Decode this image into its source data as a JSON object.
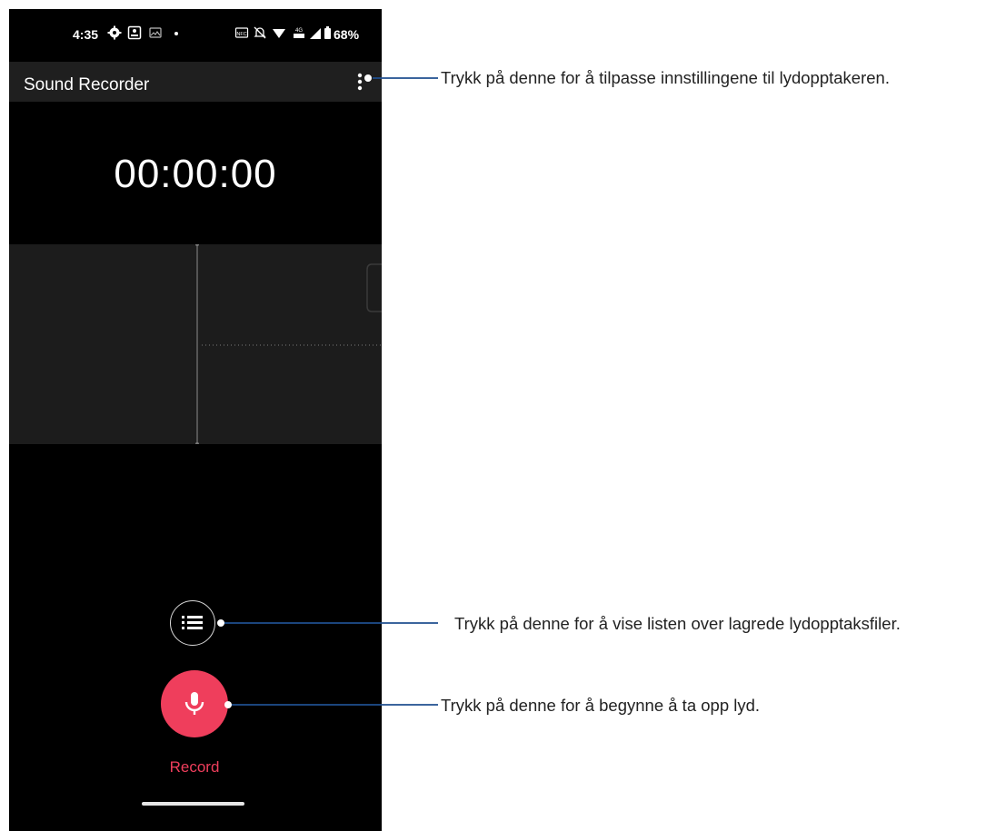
{
  "status_bar": {
    "time": "4:35",
    "battery_percent": "68%",
    "icons": [
      "settings-icon",
      "photo-icon",
      "image-icon",
      "dot-icon",
      "nfc-icon",
      "mute-icon",
      "wifi-icon",
      "lte-icon",
      "signal-icon",
      "battery-icon"
    ]
  },
  "app_bar": {
    "title": "Sound Recorder",
    "menu_icon": "more-vert-icon"
  },
  "timer": "00:00:00",
  "controls": {
    "list_icon": "list-icon",
    "record_icon": "mic-icon",
    "record_label": "Record"
  },
  "callouts": [
    {
      "target": "more-menu",
      "text": "Trykk på denne for å tilpasse innstillingene til lydopptakeren."
    },
    {
      "target": "list-button",
      "text": "Trykk på denne for å vise listen over lagrede lydopptaksfiler."
    },
    {
      "target": "record-button",
      "text": "Trykk på denne for å begynne å ta opp lyd."
    }
  ],
  "colors": {
    "accent": "#ef3e5c",
    "callout_line": "#1f4f8f",
    "phone_bg": "#000000",
    "appbar_bg": "#1f1f1f",
    "waveform_bg": "#1c1c1c"
  }
}
